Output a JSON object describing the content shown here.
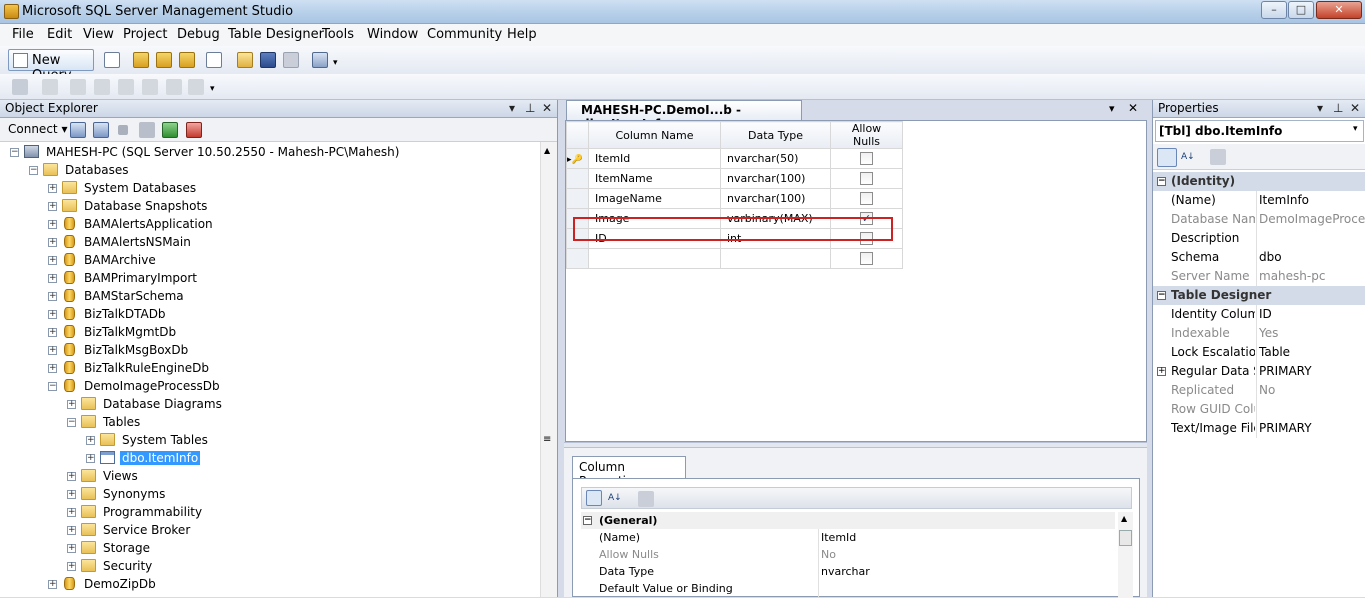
{
  "window": {
    "title": "Microsoft SQL Server Management Studio"
  },
  "menu": [
    "File",
    "Edit",
    "View",
    "Project",
    "Debug",
    "Table Designer",
    "Tools",
    "Window",
    "Community",
    "Help"
  ],
  "toolbar": {
    "new_query_label": "New Query"
  },
  "object_explorer": {
    "title": "Object Explorer",
    "connect_label": "Connect",
    "tree": [
      {
        "label": "MAHESH-PC (SQL Server 10.50.2550 - Mahesh-PC\\Mahesh)",
        "level": 0,
        "icon": "server-icon",
        "expanded": true
      },
      {
        "label": "Databases",
        "level": 1,
        "icon": "folder-icon",
        "expanded": true
      },
      {
        "label": "System Databases",
        "level": 2,
        "icon": "folder-icon",
        "expanded": false
      },
      {
        "label": "Database Snapshots",
        "level": 2,
        "icon": "folder-icon",
        "expanded": false
      },
      {
        "label": "BAMAlertsApplication",
        "level": 2,
        "icon": "database-icon",
        "expanded": false
      },
      {
        "label": "BAMAlertsNSMain",
        "level": 2,
        "icon": "database-icon",
        "expanded": false
      },
      {
        "label": "BAMArchive",
        "level": 2,
        "icon": "database-icon",
        "expanded": false
      },
      {
        "label": "BAMPrimaryImport",
        "level": 2,
        "icon": "database-icon",
        "expanded": false
      },
      {
        "label": "BAMStarSchema",
        "level": 2,
        "icon": "database-icon",
        "expanded": false
      },
      {
        "label": "BizTalkDTADb",
        "level": 2,
        "icon": "database-icon",
        "expanded": false
      },
      {
        "label": "BizTalkMgmtDb",
        "level": 2,
        "icon": "database-icon",
        "expanded": false
      },
      {
        "label": "BizTalkMsgBoxDb",
        "level": 2,
        "icon": "database-icon",
        "expanded": false
      },
      {
        "label": "BizTalkRuleEngineDb",
        "level": 2,
        "icon": "database-icon",
        "expanded": false
      },
      {
        "label": "DemoImageProcessDb",
        "level": 2,
        "icon": "database-icon",
        "expanded": true
      },
      {
        "label": "Database Diagrams",
        "level": 3,
        "icon": "folder-icon",
        "expanded": false
      },
      {
        "label": "Tables",
        "level": 3,
        "icon": "folder-icon",
        "expanded": true
      },
      {
        "label": "System Tables",
        "level": 4,
        "icon": "folder-icon",
        "expanded": false
      },
      {
        "label": "dbo.ItemInfo",
        "level": 4,
        "icon": "table-icon",
        "expanded": false,
        "selected": true
      },
      {
        "label": "Views",
        "level": 3,
        "icon": "folder-icon",
        "expanded": false
      },
      {
        "label": "Synonyms",
        "level": 3,
        "icon": "folder-icon",
        "expanded": false
      },
      {
        "label": "Programmability",
        "level": 3,
        "icon": "folder-icon",
        "expanded": false
      },
      {
        "label": "Service Broker",
        "level": 3,
        "icon": "folder-icon",
        "expanded": false
      },
      {
        "label": "Storage",
        "level": 3,
        "icon": "folder-icon",
        "expanded": false
      },
      {
        "label": "Security",
        "level": 3,
        "icon": "folder-icon",
        "expanded": false
      },
      {
        "label": "DemoZipDb",
        "level": 2,
        "icon": "database-icon",
        "expanded": false
      }
    ]
  },
  "designer": {
    "tab_title": "MAHESH-PC.DemoI...b - dbo.ItemInfo",
    "headers": [
      "Column Name",
      "Data Type",
      "Allow Nulls"
    ],
    "rows": [
      {
        "name": "ItemId",
        "type": "nvarchar(50)",
        "nulls": false,
        "key": true
      },
      {
        "name": "ItemName",
        "type": "nvarchar(100)",
        "nulls": false,
        "key": false
      },
      {
        "name": "ImageName",
        "type": "nvarchar(100)",
        "nulls": false,
        "key": false
      },
      {
        "name": "Image",
        "type": "varbinary(MAX)",
        "nulls": true,
        "key": false,
        "highlighted": true
      },
      {
        "name": "ID",
        "type": "int",
        "nulls": false,
        "key": false
      },
      {
        "name": "",
        "type": "",
        "nulls": false,
        "key": false
      }
    ],
    "column_properties": {
      "tab_label": "Column Properties",
      "category": "(General)",
      "rows": [
        {
          "k": "(Name)",
          "v": "ItemId",
          "grey": false
        },
        {
          "k": "Allow Nulls",
          "v": "No",
          "grey": true
        },
        {
          "k": "Data Type",
          "v": "nvarchar",
          "grey": false
        },
        {
          "k": "Default Value or Binding",
          "v": "",
          "grey": false
        }
      ]
    }
  },
  "properties": {
    "title": "Properties",
    "selector": "[Tbl] dbo.ItemInfo",
    "rows": [
      {
        "type": "cat",
        "k": "(Identity)"
      },
      {
        "k": "(Name)",
        "v": "ItemInfo",
        "grey": false
      },
      {
        "k": "Database Name",
        "v": "DemoImageProcess",
        "grey": true
      },
      {
        "k": "Description",
        "v": "",
        "grey": false
      },
      {
        "k": "Schema",
        "v": "dbo",
        "grey": false
      },
      {
        "k": "Server Name",
        "v": "mahesh-pc",
        "grey": true
      },
      {
        "type": "cat",
        "k": "Table Designer"
      },
      {
        "k": "Identity Column",
        "v": "ID",
        "grey": false
      },
      {
        "k": "Indexable",
        "v": "Yes",
        "grey": true
      },
      {
        "k": "Lock Escalation",
        "v": "Table",
        "grey": false
      },
      {
        "k": "Regular Data Space",
        "v": "PRIMARY",
        "grey": false,
        "expandable": true
      },
      {
        "k": "Replicated",
        "v": "No",
        "grey": true
      },
      {
        "k": "Row GUID Column",
        "v": "",
        "grey": true
      },
      {
        "k": "Text/Image Filegroup",
        "v": "PRIMARY",
        "grey": false
      }
    ]
  },
  "colors": {
    "selection": "#3399ff",
    "highlight_border": "#cc2222"
  }
}
